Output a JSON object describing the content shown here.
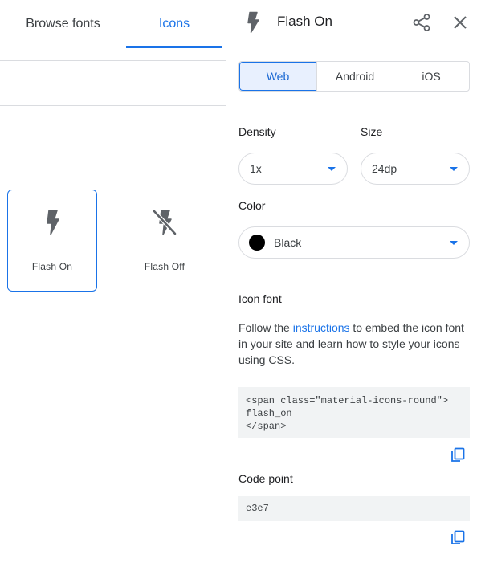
{
  "tabs": {
    "browse_fonts": "Browse fonts",
    "icons": "Icons"
  },
  "grid": {
    "items": [
      {
        "label": "Flash On",
        "icon": "flash-on-icon",
        "selected": true
      },
      {
        "label": "Flash Off",
        "icon": "flash-off-icon",
        "selected": false
      }
    ]
  },
  "detail": {
    "title": "Flash On",
    "icon": "flash-on-icon",
    "platforms": [
      "Web",
      "Android",
      "iOS"
    ],
    "selected_platform": "Web",
    "density_label": "Density",
    "density_value": "1x",
    "size_label": "Size",
    "size_value": "24dp",
    "color_label": "Color",
    "color_value": "Black",
    "color_swatch": "#000000",
    "icon_font_title": "Icon font",
    "desc_before": "Follow the ",
    "desc_link": "instructions",
    "desc_after": " to embed the icon font in your site and learn how to style your icons using CSS.",
    "code_snippet": "<span class=\"material-icons-round\">\nflash_on\n</span>",
    "code_point_title": "Code point",
    "code_point_value": "e3e7"
  },
  "colors": {
    "accent": "#1a73e8",
    "accent_bg": "#e8f0fe",
    "icon_gray": "#5f6368",
    "divider": "#dadce0",
    "code_bg": "#f1f3f4"
  }
}
